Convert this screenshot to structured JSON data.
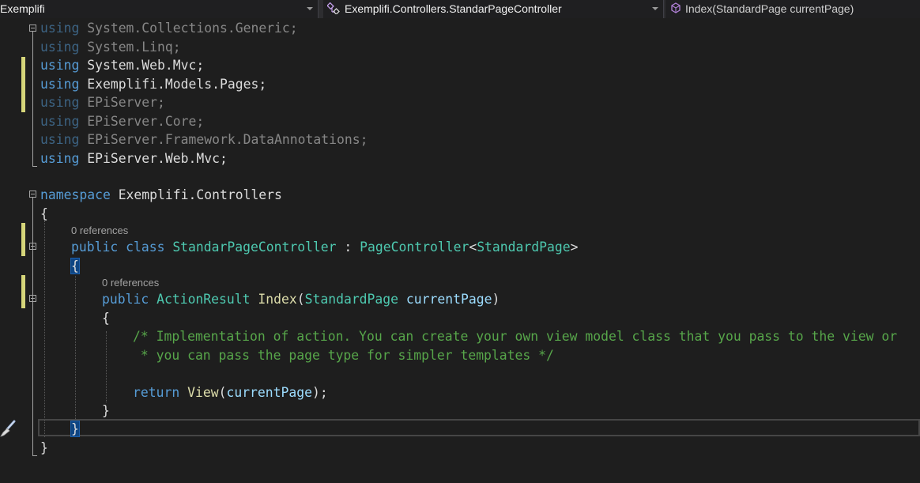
{
  "navbar": {
    "project": "Exemplifi",
    "class_scope": "Exemplifi.Controllers.StandarPageController",
    "member_scope": "Index(StandardPage currentPage)",
    "class_icon": "class-tree-icon",
    "member_icon": "method-cube-icon"
  },
  "code": {
    "usings": [
      {
        "kw": "using",
        "ns": "System.Collections.Generic",
        "end": ";"
      },
      {
        "kw": "using",
        "ns": "System.Linq",
        "end": ";"
      },
      {
        "kw": "using",
        "ns": "System.Web.Mvc",
        "end": ";"
      },
      {
        "kw": "using",
        "ns": "Exemplifi.Models.Pages",
        "end": ";"
      },
      {
        "kw": "using",
        "ns": "EPiServer",
        "end": ";"
      },
      {
        "kw": "using",
        "ns": "EPiServer.Core",
        "end": ";"
      },
      {
        "kw": "using",
        "ns": "EPiServer.Framework.DataAnnotations",
        "end": ";"
      },
      {
        "kw": "using",
        "ns": "EPiServer.Web.Mvc",
        "end": ";"
      }
    ],
    "ns_kw": "namespace",
    "ns_name": "Exemplifi.Controllers",
    "open_brace": "{",
    "close_brace": "}",
    "class_refs": "0 references",
    "class_public": "public",
    "class_kw": "class",
    "class_name": "StandarPageController",
    "class_colon": " : ",
    "base_type": "PageController",
    "lt": "<",
    "base_arg": "StandardPage",
    "gt": ">",
    "method_refs": "0 references",
    "method_public": "public",
    "return_type": "ActionResult",
    "method_name": "Index",
    "open_paren": "(",
    "param_type": "StandardPage",
    "param_name": "currentPage",
    "close_paren": ")",
    "comment_line1": "/* Implementation of action. You can create your own view model class that you pass to the view or",
    "comment_line2": " * you can pass the page type for simpler templates */",
    "return_kw": "return",
    "view_call": "View",
    "return_arg": "currentPage",
    "return_end": ");"
  },
  "colors": {
    "background": "#1e1e1e",
    "keyword": "#569cd6",
    "type": "#4ec9b0",
    "method": "#dcdcaa",
    "parameter": "#9cdcfe",
    "comment": "#57a64a",
    "change_marker": "#d6d67a"
  },
  "margin": {
    "brush_icon": "paintbrush-icon"
  }
}
